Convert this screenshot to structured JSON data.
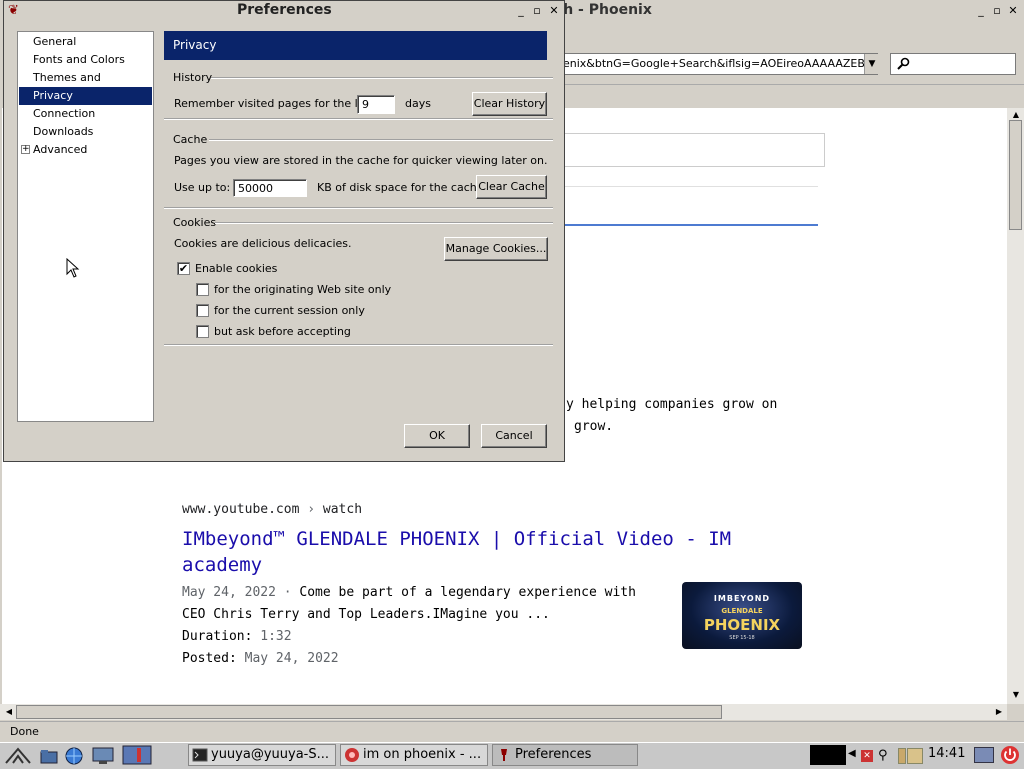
{
  "browser": {
    "title": "rch - Phoenix",
    "url": "enix&btnG=Google+Search&iflsig=AOEireoAAAAAZEBDni-YLKu",
    "status": "Done",
    "snippet_line1": "y helping companies grow on",
    "snippet_line2": "grow.",
    "result": {
      "url_site": "www.youtube.com",
      "url_sep": "›",
      "url_path": "watch",
      "title": "IMbeyond™ GLENDALE PHOENIX | Official Video - IM academy",
      "date": "May 24, 2022",
      "snippet_a": "Come be part of a legendary experience with",
      "snippet_b": "CEO Chris Terry and Top Leaders.IMagine you ...",
      "duration_label": "Duration:",
      "duration": "1:32",
      "posted_label": "Posted:",
      "posted": "May 24, 2022",
      "thumb": {
        "brand": "IMBEYOND",
        "line1": "GLENDALE",
        "line2": "PHOENIX",
        "date": "SEP 15-18"
      }
    }
  },
  "prefs": {
    "title": "Preferences",
    "categories": [
      "General",
      "Fonts and Colors",
      "Themes and Extensions",
      "Privacy",
      "Connection",
      "Downloads",
      "Advanced"
    ],
    "selected_category": "Privacy",
    "panel_title": "Privacy",
    "history": {
      "label": "History",
      "remember_text": "Remember visited pages for the last",
      "days_value": "9",
      "days_label": "days",
      "clear_button": "Clear History"
    },
    "cache": {
      "label": "Cache",
      "description": "Pages you view are stored in the cache for quicker viewing later on.",
      "use_up_to": "Use up to:",
      "size_value": "50000",
      "size_unit": "KB of disk space for the cache.",
      "clear_button": "Clear Cache"
    },
    "cookies": {
      "label": "Cookies",
      "description": "Cookies are delicious delicacies.",
      "manage_button": "Manage Cookies...",
      "enable": {
        "label": "Enable cookies",
        "checked": true
      },
      "originating": {
        "label": "for the originating Web site only",
        "checked": false
      },
      "session": {
        "label": "for the current session only",
        "checked": false
      },
      "ask": {
        "label": "but ask before accepting",
        "checked": false
      }
    },
    "ok_button": "OK",
    "cancel_button": "Cancel"
  },
  "taskbar": {
    "tasks": [
      {
        "label": "yuuya@yuuya-S...",
        "icon": "terminal-icon"
      },
      {
        "label": "im on phoenix - ...",
        "icon": "browser-icon"
      },
      {
        "label": "Preferences",
        "icon": "prefs-icon"
      }
    ],
    "clock": "14:41"
  }
}
